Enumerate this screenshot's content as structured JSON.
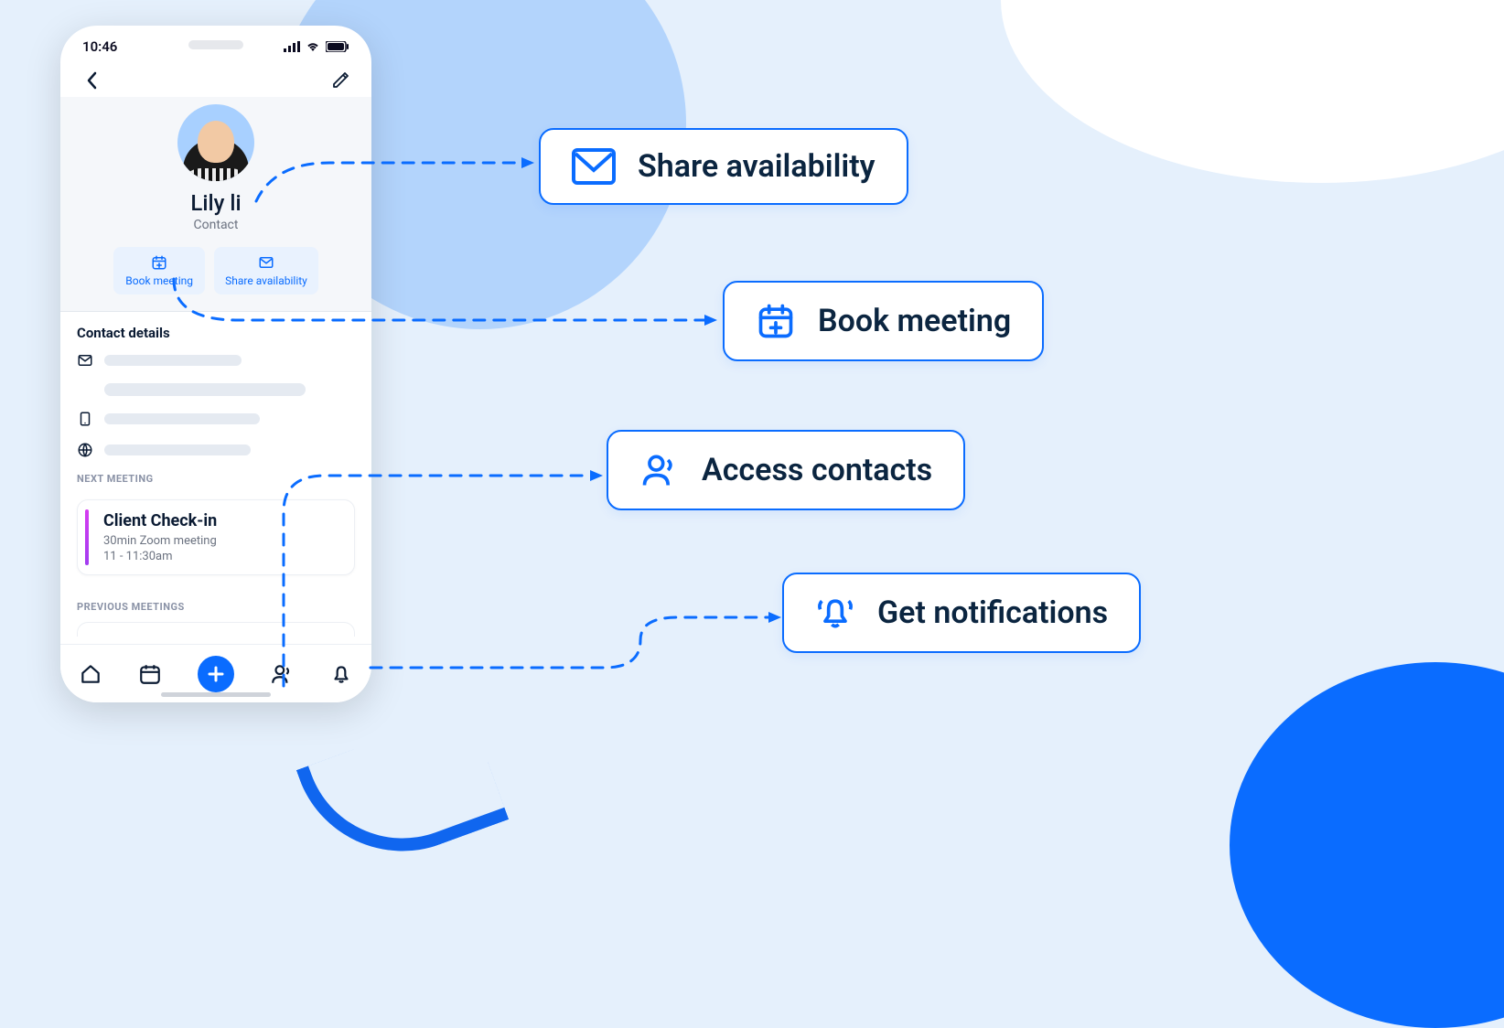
{
  "phone": {
    "status_time": "10:46",
    "contact_name": "Lily li",
    "contact_role": "Contact",
    "actions": {
      "book_meeting": "Book meeting",
      "share_availability": "Share availability"
    },
    "sections": {
      "contact_details": "Contact details",
      "next_meeting": "NEXT MEETING",
      "previous_meetings": "PREVIOUS MEETINGS"
    },
    "next_meeting": {
      "title": "Client Check-in",
      "subtitle": "30min Zoom meeting",
      "time": "11 - 11:30am"
    }
  },
  "callouts": {
    "share_availability": "Share availability",
    "book_meeting": "Book meeting",
    "access_contacts": "Access contacts",
    "get_notifications": "Get notifications"
  }
}
